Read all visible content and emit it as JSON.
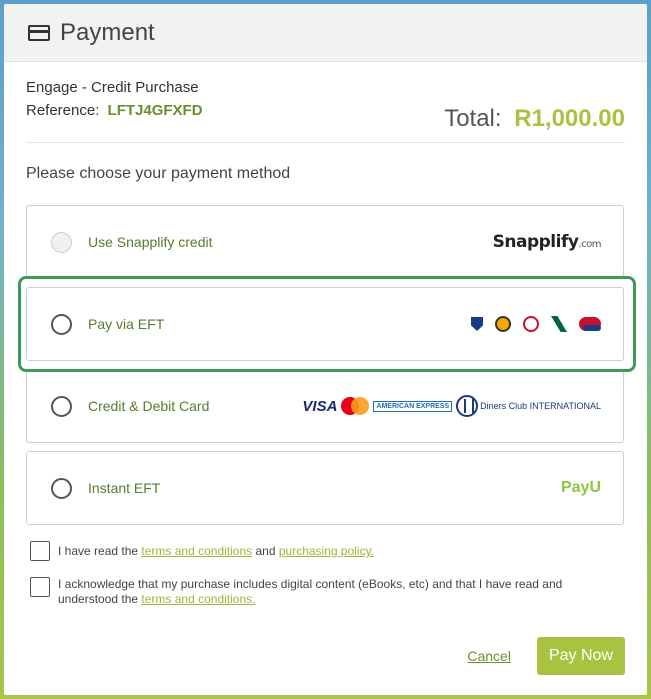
{
  "modal": {
    "title": "Payment"
  },
  "summary": {
    "product": "Engage - Credit Purchase",
    "reference_label": "Reference:",
    "reference_code": "LFTJ4GFXFD",
    "total_label": "Total:",
    "total_amount": "R1,000.00"
  },
  "prompt": "Please choose your payment method",
  "methods": [
    {
      "label": "Use Snapplify credit",
      "logo_text": "Snapplify",
      "logo_suffix": ".com"
    },
    {
      "label": "Pay via EFT",
      "banks": [
        "standard-bank-icon",
        "fnb-icon",
        "absa-icon",
        "nedbank-icon",
        "capitec-icon"
      ]
    },
    {
      "label": "Credit & Debit Card",
      "cards": {
        "visa": "VISA",
        "amex": "AMERICAN EXPRESS",
        "diners": "Diners Club INTERNATIONAL"
      }
    },
    {
      "label": "Instant EFT",
      "logo_text": "PayU"
    }
  ],
  "agreements": {
    "first_prefix": "I have read the",
    "first_link1": "terms and conditions",
    "first_mid": "and",
    "first_link2": "purchasing policy.",
    "second_prefix": "I acknowledge that my purchase includes digital content (eBooks, etc) and that I have read and understood the",
    "second_link": "terms and conditions."
  },
  "footer": {
    "cancel": "Cancel",
    "pay_now": "Pay Now"
  },
  "colors": {
    "accent": "#a9c23f",
    "highlight": "#3e9a5a",
    "label_green": "#5a7a2e"
  }
}
